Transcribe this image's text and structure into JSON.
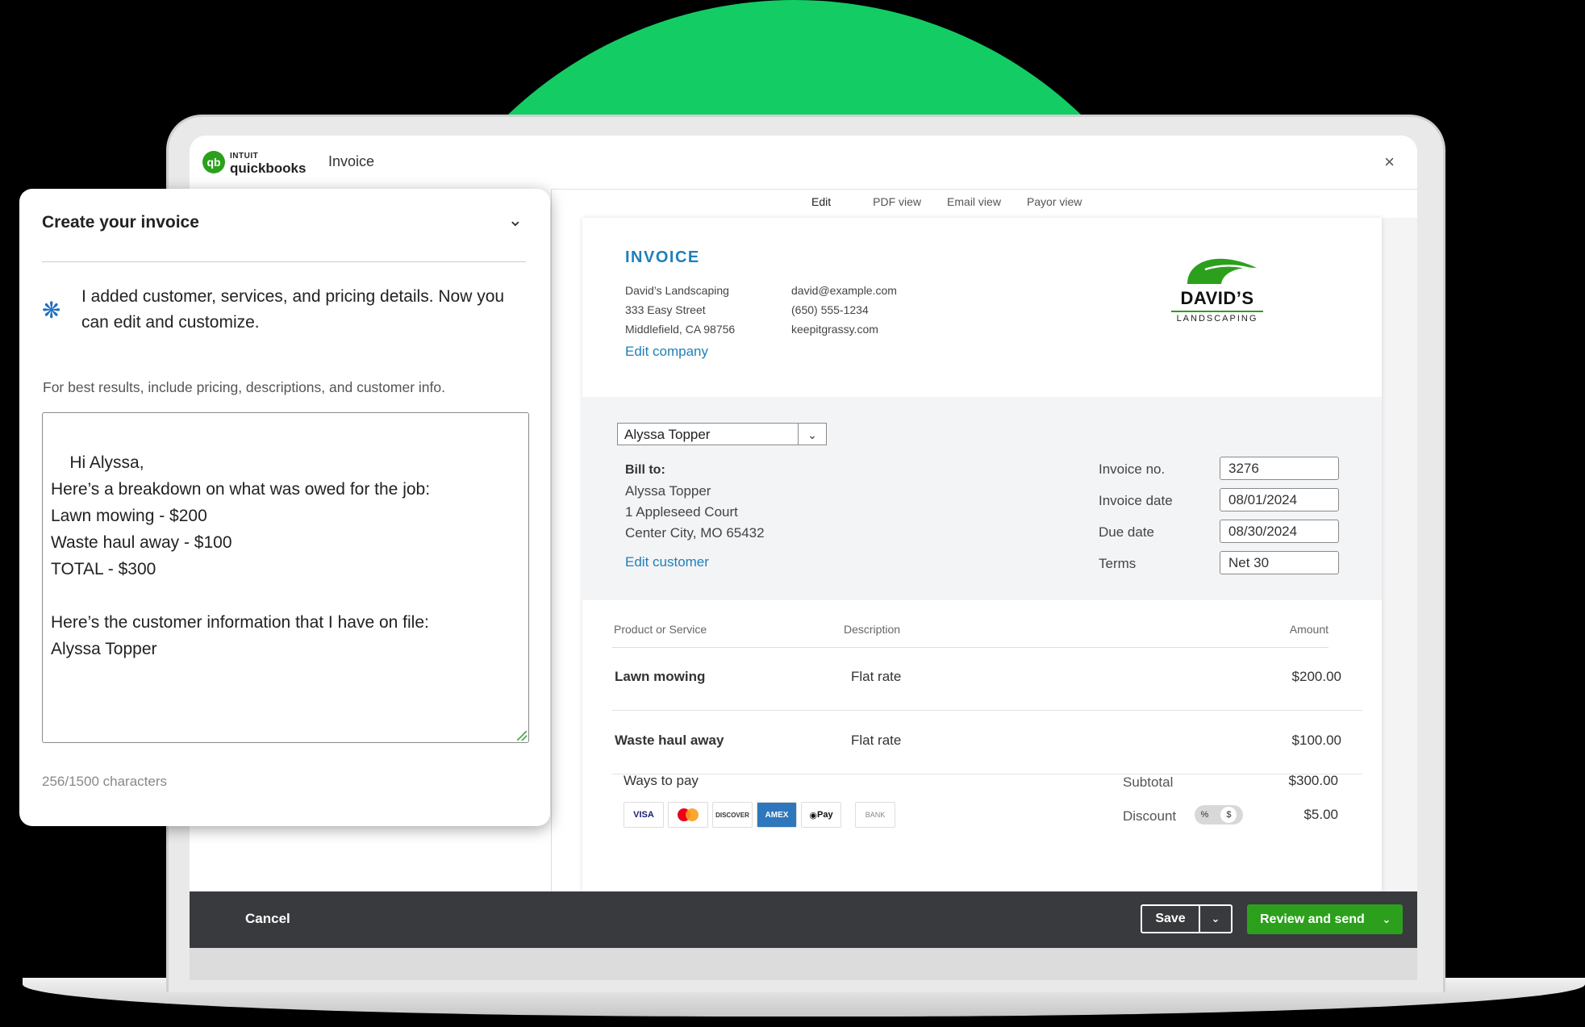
{
  "app": {
    "brand_small": "INTUIT",
    "brand_big": "quickbooks",
    "window_title": "Invoice",
    "close_glyph": "×"
  },
  "tabs": [
    {
      "label": "Edit"
    },
    {
      "label": "PDF view"
    },
    {
      "label": "Email view"
    },
    {
      "label": "Payor view"
    }
  ],
  "invoice": {
    "heading": "INVOICE",
    "company_lines": [
      "David’s Landscaping",
      "333 Easy Street",
      "Middlefield, CA 98756"
    ],
    "contact_lines": [
      "david@example.com",
      "(650) 555-1234",
      "keepitgrassy.com"
    ],
    "edit_company": "Edit company",
    "brand_name": "DAVID’S",
    "brand_sub": "LANDSCAPING"
  },
  "customer": {
    "selected": "Alyssa Topper",
    "bill_to_label": "Bill to:",
    "address": [
      "Alyssa Topper",
      "1 Appleseed Court",
      "Center City, MO 65432"
    ],
    "edit_customer": "Edit customer"
  },
  "meta": [
    {
      "label": "Invoice no.",
      "value": "3276"
    },
    {
      "label": "Invoice date",
      "value": "08/01/2024"
    },
    {
      "label": "Due date",
      "value": "08/30/2024"
    },
    {
      "label": "Terms",
      "value": "Net 30"
    }
  ],
  "items": {
    "headers": {
      "product": "Product or Service",
      "description": "Description",
      "amount": "Amount"
    },
    "rows": [
      {
        "product": "Lawn mowing",
        "description": "Flat rate",
        "amount": "$200.00"
      },
      {
        "product": "Waste haul away",
        "description": "Flat rate",
        "amount": "$100.00"
      }
    ]
  },
  "payment": {
    "ways_label": "Ways to pay",
    "methods": [
      "VISA",
      "mastercard",
      "DISCOVER",
      "AMEX",
      "Pay",
      "BANK"
    ]
  },
  "totals": {
    "subtotal_label": "Subtotal",
    "subtotal": "$300.00",
    "discount_label": "Discount",
    "discount": "$5.00",
    "discount_modes": [
      "%",
      "$"
    ]
  },
  "footer": {
    "cancel": "Cancel",
    "save": "Save",
    "review": "Review and send"
  },
  "panel": {
    "title": "Create your invoice",
    "ai_message": "I added customer, services, and pricing details. Now you can edit and customize.",
    "hint": "For best results, include pricing, descriptions, and customer info.",
    "prompt_text": "Hi Alyssa,\nHere’s a breakdown on what was owed for the job:\nLawn mowing - $200\nWaste haul away - $100\nTOTAL - $300\n\nHere’s the customer information that I have on file:\nAlyssa Topper",
    "char_count": "256/1500 characters"
  },
  "icons": [
    "qb-logo-icon",
    "close-icon",
    "chevron-down-icon",
    "sparkle-icon",
    "leaf-logo-icon",
    "apple-icon"
  ],
  "colors": {
    "accent_green": "#2ca01c",
    "link_blue": "#1f7fbb",
    "bg_circle": "#13cc64",
    "footer_bg": "#393a3d"
  }
}
